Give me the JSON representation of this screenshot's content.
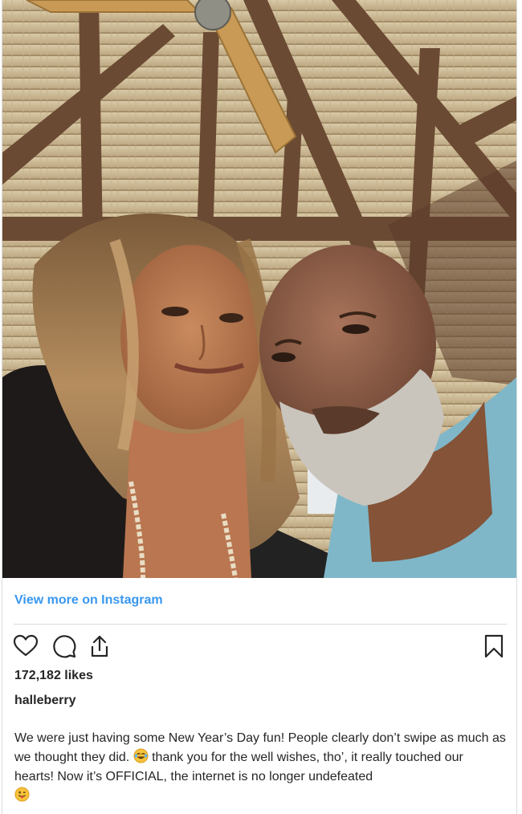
{
  "post": {
    "view_more_label": "View more on Instagram",
    "likes_text": "172,182 likes",
    "username": "halleberry",
    "caption_part1": "We were just having some New Year’s Day fun! People clearly don’t swipe as much as we thought they did. ",
    "caption_part2": " thank you for the well wishes, tho’, it really touched our hearts! Now it’s OFFICIAL, the internet is no longer undefeated ",
    "emoji_1": "😂",
    "emoji_2": "😛"
  },
  "icons": {
    "like": "heart-icon",
    "comment": "comment-icon",
    "share": "share-icon",
    "save": "bookmark-icon"
  },
  "colors": {
    "link": "#3897f0",
    "text": "#262626",
    "border": "#dbdbdb"
  }
}
